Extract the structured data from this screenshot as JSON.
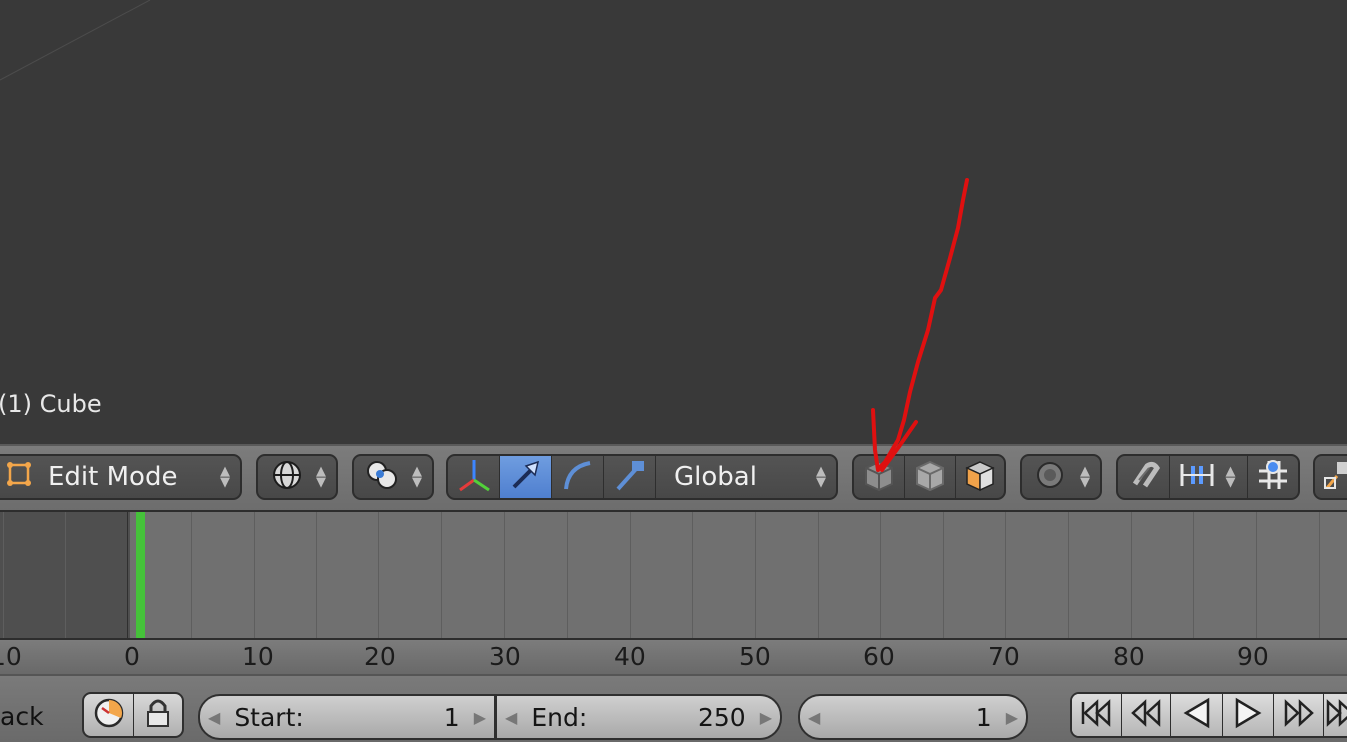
{
  "viewport": {
    "object_label": "(1) Cube"
  },
  "header_3d": {
    "mode_label": "Edit Mode",
    "orientation_label": "Global",
    "viewport_shade_icon": "sphere-shade-icon",
    "pivot_icon": "pivot-icon",
    "manipulator_icons": [
      "axes-icon",
      "translate-icon",
      "rotate-icon",
      "scale-icon"
    ],
    "layer_icons": [
      "object-icon",
      "object-data-icon",
      "object-material-icon"
    ],
    "proportional_icon": "proportional-icon",
    "snap_icons": [
      "magnet-icon",
      "snap-element-icon",
      "snap-target-icon"
    ]
  },
  "timeline": {
    "ruler_ticks": [
      "10",
      "0",
      "10",
      "20",
      "30",
      "40",
      "50",
      "60",
      "70",
      "80",
      "90"
    ],
    "current_frame_color": "#45c23a"
  },
  "timeline_header": {
    "menu_label": "ack",
    "start_label": "Start:",
    "start_value": "1",
    "end_label": "End:",
    "end_value": "250",
    "current_frame_value": "1",
    "playback_icons": [
      "jump-start-icon",
      "jump-keyframe-back-icon",
      "play-reverse-icon",
      "play-icon",
      "jump-keyframe-forward-icon",
      "jump-end-icon"
    ]
  },
  "annotation": {
    "arrow_color": "#e01010"
  }
}
